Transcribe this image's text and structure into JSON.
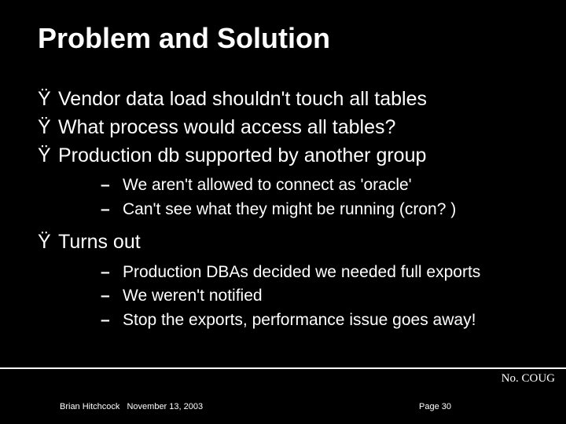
{
  "title": "Problem and Solution",
  "bulletChar": "Ÿ",
  "dashChar": "–",
  "items": [
    {
      "text": "Vendor data load shouldn't touch all tables"
    },
    {
      "text": "What process would access all tables?"
    },
    {
      "text": "Production db supported by another group",
      "sub": [
        "We aren't allowed to connect as 'oracle'",
        "Can't see what they might be running (cron? )"
      ]
    },
    {
      "text": "Turns out",
      "sub": [
        "Production DBAs decided we needed full exports",
        "We weren't notified",
        "Stop the exports, performance issue goes away!"
      ]
    }
  ],
  "org": "No. COUG",
  "footer": {
    "author": "Brian Hitchcock",
    "date": "November 13, 2003",
    "page": "Page 30"
  }
}
